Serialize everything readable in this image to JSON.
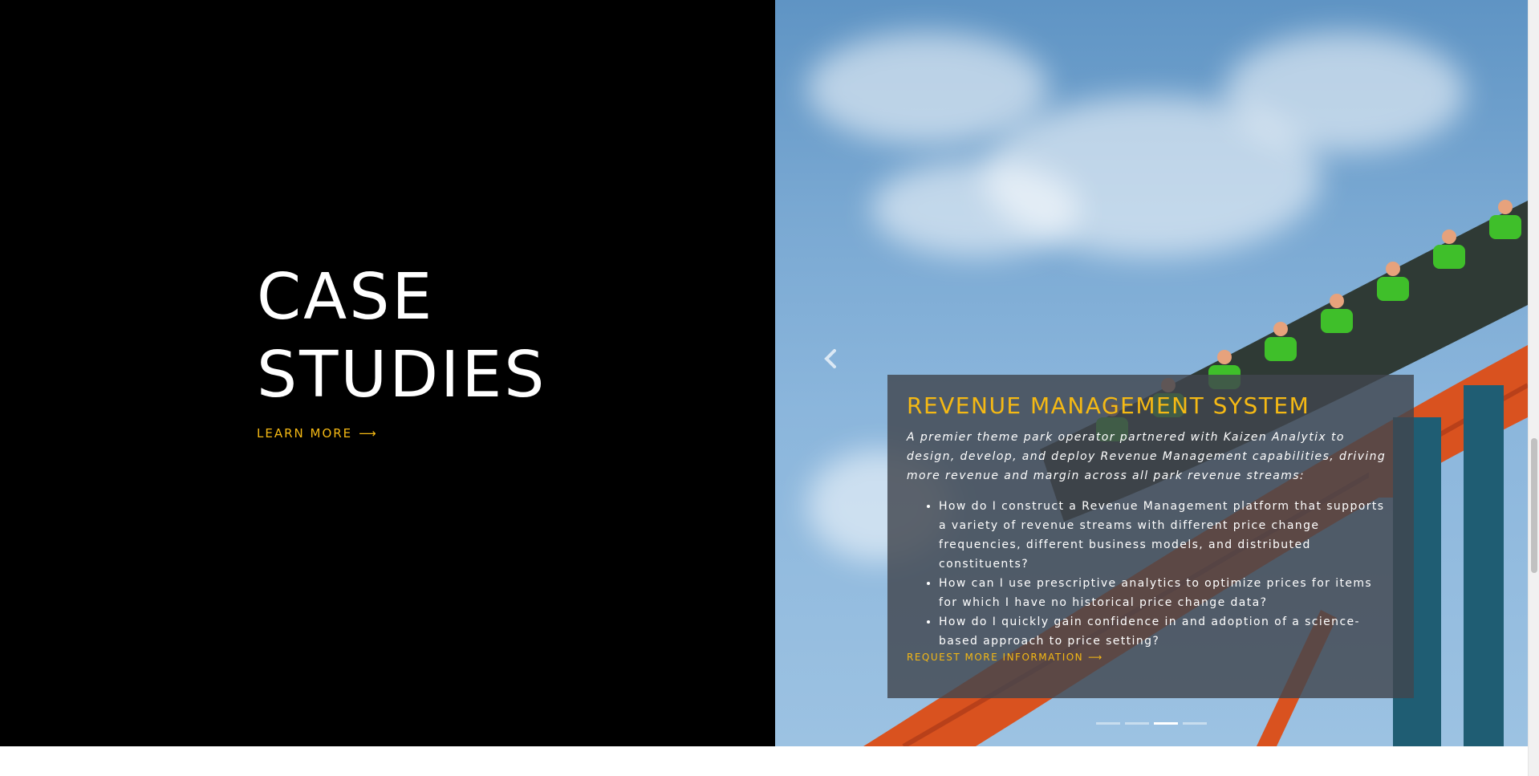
{
  "hero": {
    "title_line1": "CASE",
    "title_line2": "STUDIES",
    "learn_more_label": "LEARN MORE",
    "arrow_glyph": "⟶"
  },
  "carousel": {
    "prev_icon": "chevron-left-icon",
    "slide": {
      "title": "REVENUE MANAGEMENT SYSTEM",
      "description": "A premier theme park operator partnered with Kaizen Analytix to design, develop, and deploy Revenue Management capabilities, driving more revenue and margin across all park revenue streams:",
      "bullets": [
        "How do I construct a Revenue Management platform that supports a variety of revenue streams with different price change frequencies, different business models, and distributed constituents?",
        "How can I use prescriptive analytics to optimize prices for items for which I have no historical price change data?",
        "How do I quickly gain confidence in and adoption of a science-based approach to price setting?"
      ],
      "cta_label": "REQUEST MORE INFORMATION",
      "cta_arrow": "⟶"
    },
    "indicator_count": 4,
    "active_indicator": 3
  },
  "colors": {
    "accent": "#f5b914",
    "left_background": "#000000",
    "overlay": "#41464e"
  }
}
